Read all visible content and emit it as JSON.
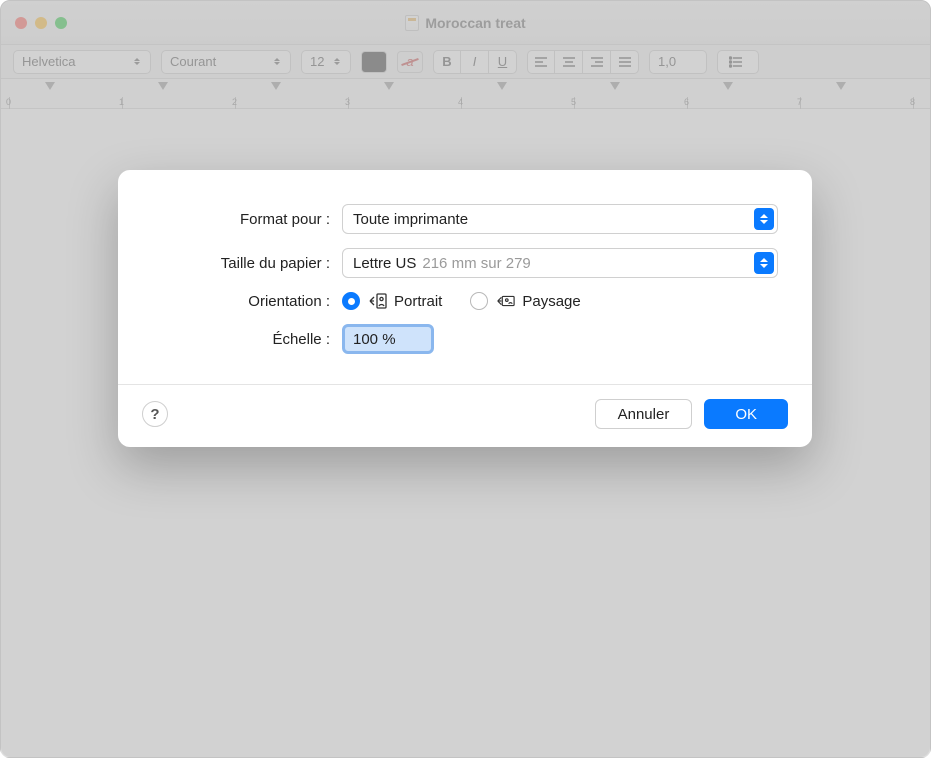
{
  "window": {
    "title": "Moroccan treat"
  },
  "toolbar": {
    "font": "Helvetica",
    "style": "Courant",
    "size": "12",
    "line_spacing": "1,0"
  },
  "ruler": {
    "ticks": [
      "0",
      "1",
      "2",
      "3",
      "4",
      "5",
      "6",
      "7",
      "8"
    ]
  },
  "dialog": {
    "format_label": "Format pour :",
    "format_value": "Toute imprimante",
    "paper_label": "Taille du papier :",
    "paper_value": "Lettre US",
    "paper_detail": "216 mm sur 279",
    "orientation_label": "Orientation :",
    "orientation_portrait": "Portrait",
    "orientation_landscape": "Paysage",
    "scale_label": "Échelle :",
    "scale_value": "100 %",
    "help": "?",
    "cancel": "Annuler",
    "ok": "OK"
  }
}
